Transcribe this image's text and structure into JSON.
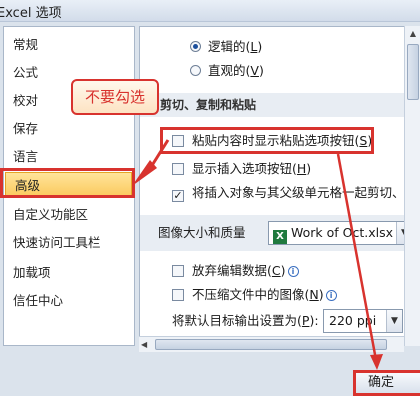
{
  "window": {
    "title": "Excel 选项"
  },
  "nav": {
    "items": [
      {
        "label": "常规"
      },
      {
        "label": "公式"
      },
      {
        "label": "校对"
      },
      {
        "label": "保存"
      },
      {
        "label": "语言"
      },
      {
        "label": "高级",
        "selected": true
      },
      {
        "label": "自定义功能区"
      },
      {
        "label": "快速访问工具栏"
      },
      {
        "label": "加载项"
      },
      {
        "label": "信任中心"
      }
    ]
  },
  "main": {
    "radio_logical": "逻辑的(",
    "radio_logical_key": "L",
    "radio_logical_end": ")",
    "radio_visual": "直观的(",
    "radio_visual_key": "V",
    "radio_visual_end": ")",
    "section_cut_copy_paste": "剪切、复制和粘贴",
    "opt_paste_options": "粘贴内容时显示粘贴选项按钮(",
    "opt_paste_options_key": "S",
    "opt_paste_options_end": ")",
    "opt_insert_options": "显示插入选项按钮(",
    "opt_insert_options_key": "H",
    "opt_insert_options_end": ")",
    "opt_cut_copy_sort": "将插入对象与其父级单元格一起剪切、复制",
    "section_image": "图像大小和质量",
    "image_workbook_select": "Work of Oct.xlsx",
    "opt_discard_edit": "放弃编辑数据(",
    "opt_discard_edit_key": "C",
    "opt_discard_edit_end": ")",
    "opt_no_compress": "不压缩文件中的图像(",
    "opt_no_compress_key": "N",
    "opt_no_compress_end": ")",
    "default_output_label": "将默认目标输出设置为(",
    "default_output_key": "P",
    "default_output_end": "):",
    "default_output_value": "220 ppi"
  },
  "annotation": {
    "callout": "不要勾选"
  },
  "footer": {
    "ok_label": "确定"
  },
  "colors": {
    "highlight": "#d8332e",
    "nav_selected": "#fbc95c"
  },
  "icons": [
    "excel-file-icon",
    "info-icon",
    "dropdown-arrow-icon",
    "checkmark-icon"
  ]
}
